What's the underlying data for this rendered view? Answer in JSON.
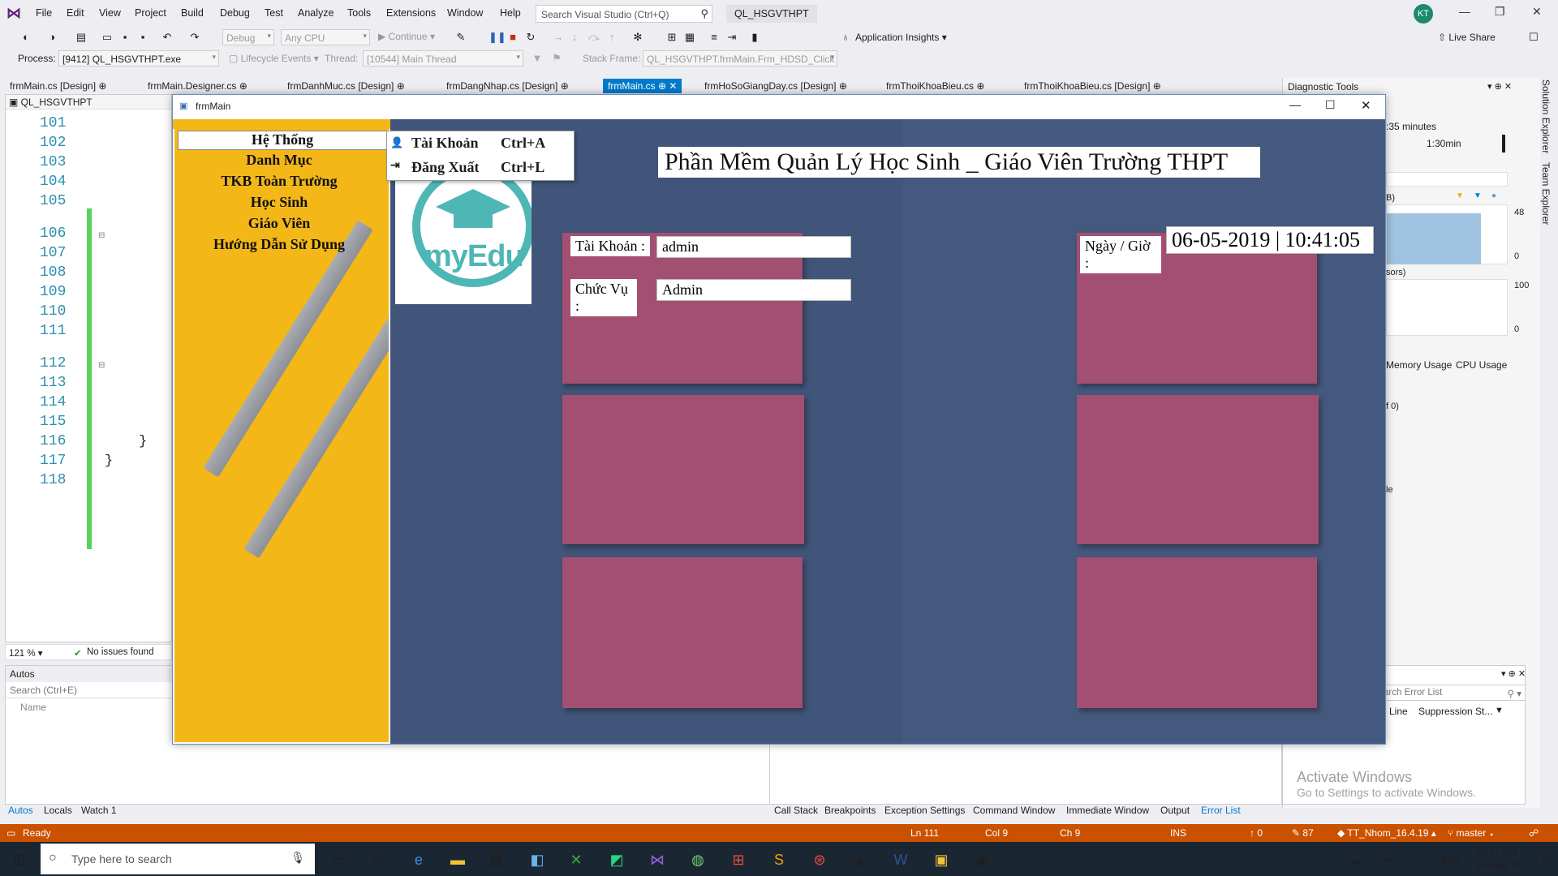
{
  "menubar": {
    "items": [
      "File",
      "Edit",
      "View",
      "Project",
      "Build",
      "Debug",
      "Test",
      "Analyze",
      "Tools",
      "Extensions",
      "Window",
      "Help"
    ],
    "search_placeholder": "Search Visual Studio (Ctrl+Q)",
    "solution_name": "QL_HSGVTHPT",
    "avatar": "KT"
  },
  "toolbar": {
    "config": "Debug",
    "platform": "Any CPU",
    "continue": "Continue",
    "app_insights": "Application Insights",
    "live_share": "Live Share"
  },
  "toolbar2": {
    "process_label": "Process:",
    "process_value": "[9412] QL_HSGVTHPT.exe",
    "lifecycle": "Lifecycle Events",
    "thread_label": "Thread:",
    "thread_value": "[10544] Main Thread",
    "stackframe_label": "Stack Frame:",
    "stackframe_value": "QL_HSGVTHPT.frmMain.Frm_HDSD_Click"
  },
  "doc_tabs": [
    "frmMain.cs [Design]",
    "frmMain.Designer.cs",
    "frmDanhMuc.cs [Design]",
    "frmDangNhap.cs [Design]",
    "frmMain.cs",
    "frmHoSoGiangDay.cs [Design]",
    "frmThoiKhoaBieu.cs",
    "frmThoiKhoaBieu.cs [Design]"
  ],
  "editor": {
    "project": "QL_HSGVTHPT",
    "line_numbers": [
      "101",
      "102",
      "103",
      "104",
      "105",
      "106",
      "107",
      "108",
      "109",
      "110",
      "111",
      "112",
      "113",
      "114",
      "115",
      "116",
      "117",
      "118"
    ],
    "zoom": "121 %",
    "issues": "No issues found",
    "brace1": "}",
    "brace2": "}"
  },
  "autos": {
    "title": "Autos",
    "search": "Search (Ctrl+E)",
    "col_name": "Name",
    "tabs": [
      "Autos",
      "Locals",
      "Watch 1"
    ]
  },
  "bottom_tabs": [
    "Call Stack",
    "Breakpoints",
    "Exception Settings",
    "Command Window",
    "Immediate Window",
    "Output",
    "Error List"
  ],
  "diagnostics": {
    "title": "Diagnostic Tools",
    "duration": ":35 minutes",
    "time_mark": "1:30min",
    "mem_label": "B)",
    "mem_max": "48",
    "mem_min": "0",
    "cpu_label": "sors)",
    "cpu_max": "100",
    "cpu_min": "0",
    "tab_mem": "Memory Usage",
    "tab_cpu": "CPU Usage",
    "of_text": "f 0)",
    "le_text": "le",
    "errlist_search": "arch Error List",
    "col_line": "Line",
    "col_supp": "Suppression St..."
  },
  "side_tabs": [
    "Solution Explorer",
    "Team Explorer"
  ],
  "activate": {
    "line1": "Activate Windows",
    "line2": "Go to Settings to activate Windows."
  },
  "status": {
    "ready": "Ready",
    "ln": "Ln 111",
    "col": "Col 9",
    "ch": "Ch 9",
    "ins": "INS",
    "up": "0",
    "pencil": "87",
    "repo": "TT_Nhom_16.4.19",
    "branch": "master"
  },
  "taskbar": {
    "search": "Type here to search",
    "lang": "ENG",
    "time": "10:41 PM",
    "date": "06-May-19",
    "notif": "20"
  },
  "form": {
    "title": "frmMain",
    "sidebar": [
      "Hệ Thống",
      "Danh Mục",
      "TKB Toàn Trường",
      "Học Sinh",
      "Giáo Viên",
      "Hướng Dẫn Sử Dụng"
    ],
    "dropdown": [
      {
        "label": "Tài Khoản",
        "shortcut": "Ctrl+A"
      },
      {
        "label": "Đăng Xuất",
        "shortcut": "Ctrl+L"
      }
    ],
    "logo_text": "myEdu",
    "app_title": "Phần Mềm Quản Lý Học Sinh _ Giáo Viên Trường THPT",
    "account_label": "Tài Khoản :",
    "account_value": "admin",
    "role_label": "Chức Vụ :",
    "role_value": "Admin",
    "datetime_label": "Ngày / Giờ :",
    "datetime_value": "06-05-2019 | 10:41:05"
  },
  "colors": {
    "accent": "#007acc",
    "statusbar": "#ca5100",
    "sidebar": "#f3b718",
    "board": "#a34f72",
    "background": "#41557a"
  }
}
